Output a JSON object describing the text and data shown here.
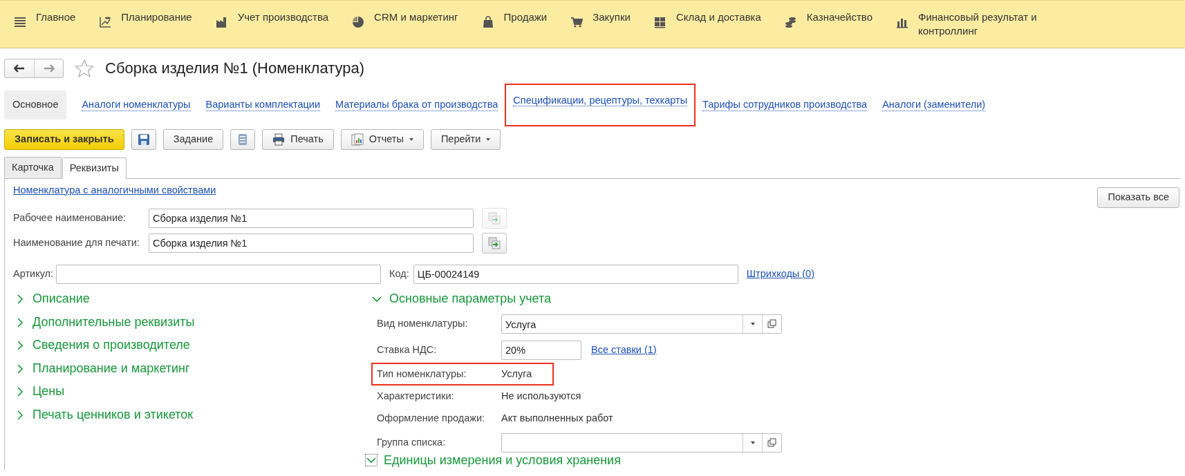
{
  "top_menu": [
    {
      "label": "Главное"
    },
    {
      "label": "Планирование"
    },
    {
      "label": "Учет производства"
    },
    {
      "label": "CRM и маркетинг"
    },
    {
      "label": "Продажи"
    },
    {
      "label": "Закупки"
    },
    {
      "label": "Склад и доставка"
    },
    {
      "label": "Казначейство"
    },
    {
      "label": "Финансовый результат и контроллинг"
    }
  ],
  "title": "Сборка изделия №1 (Номенклатура)",
  "favorite": false,
  "nav_links": [
    {
      "label": "Основное",
      "selected": true,
      "highlighted": false
    },
    {
      "label": "Аналоги номенклатуры",
      "selected": false,
      "highlighted": false
    },
    {
      "label": "Варианты комплектации",
      "selected": false,
      "highlighted": false
    },
    {
      "label": "Материалы брака от производства",
      "selected": false,
      "highlighted": false
    },
    {
      "label": "Спецификации, рецептуры, техкарты",
      "selected": false,
      "highlighted": true
    },
    {
      "label": "Тарифы сотрудников производства",
      "selected": false,
      "highlighted": false
    },
    {
      "label": "Аналоги (заменители)",
      "selected": false,
      "highlighted": false
    }
  ],
  "toolbar": [
    {
      "kind": "primary",
      "label": "Записать и закрыть"
    },
    {
      "kind": "save"
    },
    {
      "kind": "plain",
      "label": "Задание"
    },
    {
      "kind": "list"
    },
    {
      "kind": "print",
      "label": "Печать"
    },
    {
      "kind": "reports",
      "label": "Отчеты"
    },
    {
      "kind": "goto",
      "label": "Перейти"
    }
  ],
  "form_tabs": [
    {
      "label": "Карточка",
      "selected": false
    },
    {
      "label": "Реквизиты",
      "selected": true
    }
  ],
  "similar_link": "Номенклатура с аналогичными свойствами",
  "show_all_button": "Показать все",
  "working_name": {
    "label": "Рабочее наименование:",
    "value": "Сборка изделия №1",
    "disabled": true
  },
  "print_name": {
    "label": "Наименование для печати:",
    "value": "Сборка изделия №1",
    "disabled": false
  },
  "article": {
    "label": "Артикул:"
  },
  "code": {
    "label": "Код:",
    "value": "ЦБ-00024149"
  },
  "barcodes_link": "Штрихкоды (0)",
  "sections": [
    {
      "label": "Описание",
      "expanded": false
    },
    {
      "label": "Дополнительные реквизиты",
      "expanded": false
    },
    {
      "label": "Сведения о производителе",
      "expanded": false
    },
    {
      "label": "Планирование и маркетинг",
      "expanded": false
    },
    {
      "label": "Цены",
      "expanded": false
    },
    {
      "label": "Печать ценников и этикеток",
      "expanded": false
    }
  ],
  "main_params": {
    "label": "Основные параметры учета",
    "expanded": true,
    "rows": [
      {
        "kind": "select",
        "label": "Вид номенклатуры:",
        "value": "Услуга",
        "highlighted": false
      },
      {
        "kind": "input",
        "label": "Ставка НДС:",
        "value": "20%",
        "link": "Все ставки (1)",
        "highlighted": false
      },
      {
        "kind": "text",
        "label": "Тип номенклатуры:",
        "value": "Услуга",
        "highlighted": true
      },
      {
        "kind": "text",
        "label": "Характеристики:",
        "value": "Не используются",
        "highlighted": false
      },
      {
        "kind": "text",
        "label": "Оформление продажи:",
        "value": "Акт выполненных работ",
        "highlighted": false
      },
      {
        "kind": "select",
        "label": "Группа списка:",
        "highlighted": false
      }
    ]
  },
  "units_section": {
    "label": "Единицы измерения и условия хранения",
    "expanded": true
  }
}
